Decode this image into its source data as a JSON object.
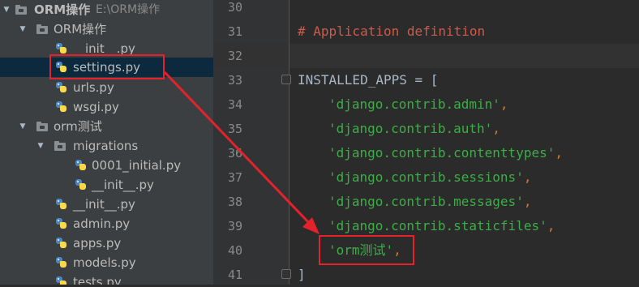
{
  "project_tree": {
    "root": {
      "name": "ORM操作",
      "path": "E:\\ORM操作"
    },
    "items": [
      {
        "label": "ORM操作",
        "type": "folder"
      },
      {
        "label": "__init__.py",
        "type": "python-file"
      },
      {
        "label": "settings.py",
        "type": "python-file",
        "selected": true
      },
      {
        "label": "urls.py",
        "type": "python-file"
      },
      {
        "label": "wsgi.py",
        "type": "python-file"
      },
      {
        "label": "orm测试",
        "type": "folder"
      },
      {
        "label": "migrations",
        "type": "folder"
      },
      {
        "label": "0001_initial.py",
        "type": "python-file"
      },
      {
        "label": "__init__.py",
        "type": "python-file"
      },
      {
        "label": "__init__.py",
        "type": "python-file"
      },
      {
        "label": "admin.py",
        "type": "python-file"
      },
      {
        "label": "apps.py",
        "type": "python-file"
      },
      {
        "label": "models.py",
        "type": "python-file"
      },
      {
        "label": "tests.py",
        "type": "python-file"
      }
    ]
  },
  "editor": {
    "line_numbers": [
      "30",
      "31",
      "32",
      "33",
      "34",
      "35",
      "36",
      "37",
      "38",
      "39",
      "40",
      "41"
    ],
    "comment": "# Application definition",
    "installed_apps_name": "INSTALLED_APPS",
    "assign": " = [",
    "apps": [
      "'django.contrib.admin'",
      "'django.contrib.auth'",
      "'django.contrib.contenttypes'",
      "'django.contrib.sessions'",
      "'django.contrib.messages'",
      "'django.contrib.staticfiles'"
    ],
    "new_app": "'orm测试'",
    "comma": ",",
    "close_bracket": "]"
  },
  "colors": {
    "annotation_red": "#e3222b",
    "comment": "#cc5b4b",
    "string": "#6a8759",
    "keyword_orange": "#cc7832",
    "selection": "#0d293e"
  }
}
